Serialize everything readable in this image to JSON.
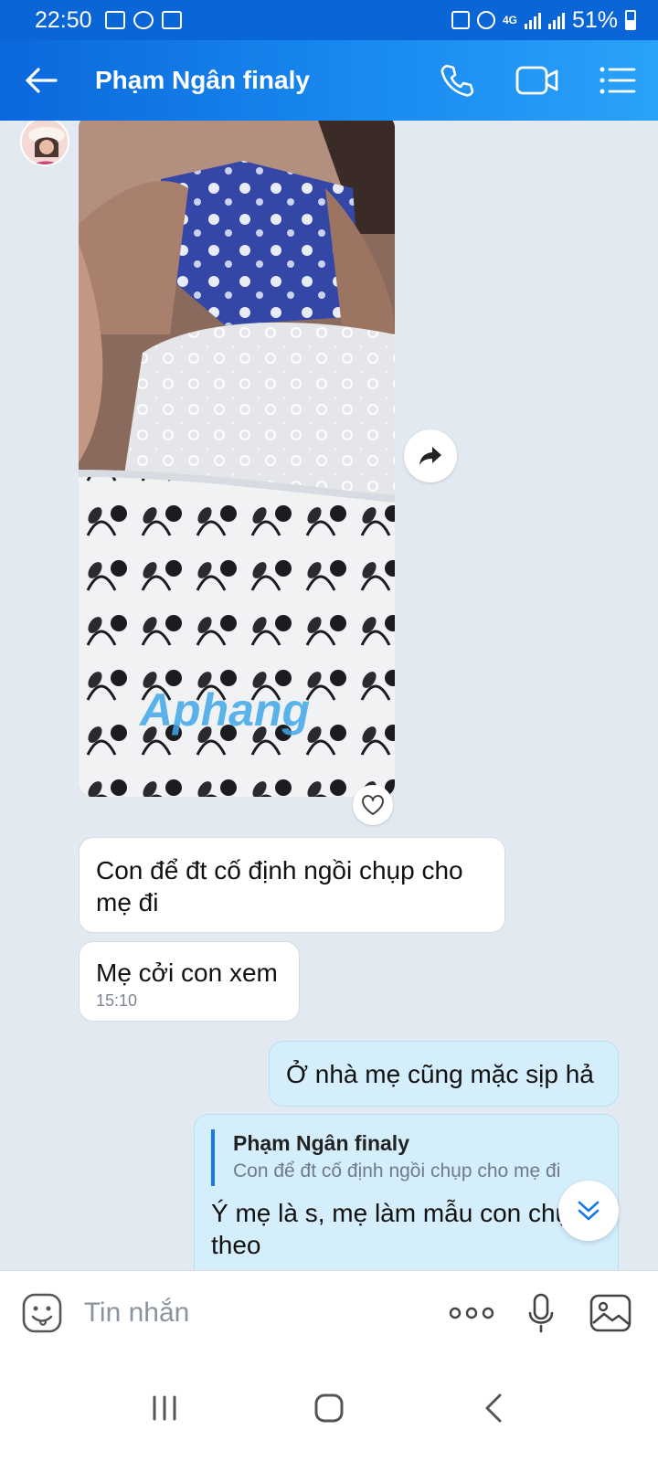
{
  "status_bar": {
    "time": "22:50",
    "network": "4G",
    "battery": "51%"
  },
  "header": {
    "title": "Phạm Ngân finaly",
    "icons": [
      "back-arrow-icon",
      "phone-icon",
      "video-call-icon",
      "list-menu-icon"
    ]
  },
  "chat": {
    "photo": {
      "watermark": "Aphang"
    },
    "messages": [
      {
        "direction": "incoming",
        "text": "Con để đt cố định ngồi chụp cho mẹ đi"
      },
      {
        "direction": "incoming",
        "text": "Mẹ cởi con xem",
        "time": "15:10"
      },
      {
        "direction": "outgoing",
        "text": "Ở nhà mẹ cũng mặc sịp hả"
      },
      {
        "direction": "outgoing",
        "quote": {
          "name": "Phạm Ngân finaly",
          "text": "Con để đt cố định ngồi chụp cho mẹ đi"
        },
        "text": "Ý mẹ là s, mẹ làm mẫu con chụp theo"
      }
    ]
  },
  "composer": {
    "placeholder": "Tin nhắn"
  },
  "colors": {
    "accent": "#0a68dc",
    "incoming_bubble": "#ffffff",
    "outgoing_bubble": "#d5eefc",
    "chat_background": "#e2e9f1"
  }
}
